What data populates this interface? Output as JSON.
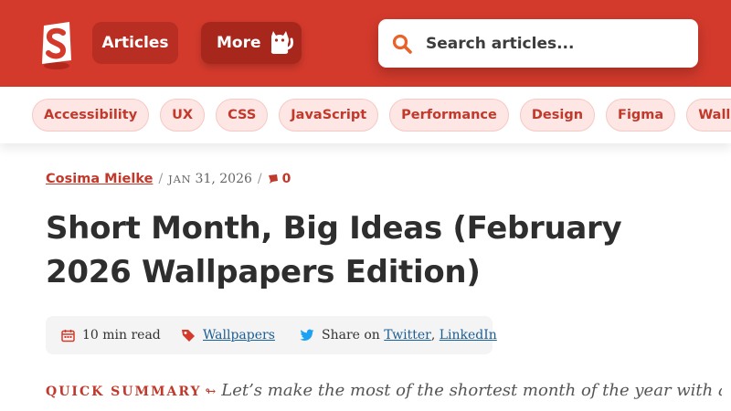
{
  "header": {
    "logo_icon": "smashing-s-logo-icon",
    "nav": [
      {
        "label": "Articles"
      },
      {
        "label": "More",
        "icon": "cat-icon"
      }
    ],
    "search": {
      "placeholder": "Search articles...",
      "value": "",
      "icon": "search-icon"
    },
    "colors": {
      "brand": "#d33a2c",
      "nav_button": "#b92e22",
      "more_button": "#a8271c"
    }
  },
  "tags": [
    "Accessibility",
    "UX",
    "CSS",
    "JavaScript",
    "Performance",
    "Design",
    "Figma",
    "Wallpapers"
  ],
  "article": {
    "author": "Cosima Mielke",
    "date_month": "JAN",
    "date_rest": "31, 2026",
    "comments_count": "0",
    "comments_icon": "comment-icon",
    "title_line1": "Short Month, Big Ideas (February",
    "title_line2": "2026 Wallpapers Edition)",
    "read_time": "10 min read",
    "category": "Wallpapers",
    "share_prefix": "Share on",
    "share_twitter": "Twitter",
    "share_sep": ",",
    "share_linkedin": "LinkedIn",
    "summary_label": "QUICK SUMMARY",
    "summary_sep": "↬",
    "summary_text": "Let’s make the most of the shortest month of the year with a new"
  }
}
